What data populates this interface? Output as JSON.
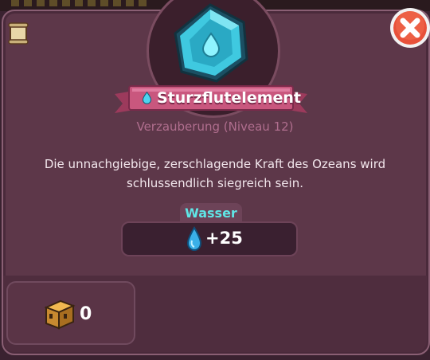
{
  "item": {
    "title": "Sturzflutelement",
    "subtitle": "Verzauberung (Niveau 12)",
    "description": "Die unnachgiebige, zerschlagende Kraft des Ozeans wird schlussendlich siegreich sein.",
    "element_icon": "water-drop-icon",
    "gem_icon": "hexagon-water-gem-icon"
  },
  "stat": {
    "label": "Wasser",
    "value": "+25",
    "icon": "water-drop-icon"
  },
  "inventory": {
    "icon": "treasure-chest-icon",
    "count": "0"
  },
  "buttons": {
    "close_icon": "close-icon",
    "scroll_icon": "scroll-icon"
  },
  "colors": {
    "panel": "#5d3749",
    "accent_water": "#3fc9e0",
    "close_red": "#e8513a",
    "label_cyan": "#5fe6e6"
  }
}
